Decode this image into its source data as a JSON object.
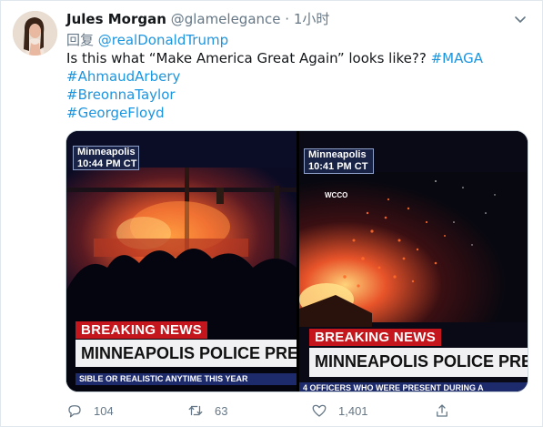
{
  "tweet": {
    "author_name": "Jules Morgan",
    "handle": "@glamelegance",
    "separator": "·",
    "time": "1小时",
    "reply_prefix": "回复",
    "reply_to": "@realDonaldTrump",
    "text_line1": "Is this what “Make America Great Again” looks like??",
    "hashtags": [
      "#MAGA",
      "#AhmaudArbery",
      "#BreonnaTaylor",
      "#GeorgeFloyd"
    ]
  },
  "media": {
    "left": {
      "city": "Minneapolis",
      "time": "10:44 PM CT",
      "breaking": "BREAKING NEWS",
      "headline": "MINNEAPOLIS POLICE PRECINCT ON F",
      "ticker": "SIBLE OR REALISTIC ANYTIME THIS YEAR"
    },
    "right": {
      "city": "Minneapolis",
      "time": "10:41 PM CT",
      "station": "WCCO",
      "breaking": "BREAKING NEWS",
      "headline": "MINNEAPOLIS POLICE PRECINCT ON",
      "ticker": "4 OFFICERS WHO WERE PRESENT DURING A"
    }
  },
  "actions": {
    "reply_count": "104",
    "retweet_count": "63",
    "like_count": "1,401"
  },
  "icons": {
    "reply": "reply-icon",
    "retweet": "retweet-icon",
    "like": "heart-icon",
    "share": "share-icon",
    "more": "chevron-down-icon"
  },
  "colors": {
    "link": "#1b95e0",
    "muted": "#657786",
    "breaking_red": "#c4161c",
    "ticker_blue": "#1d2a6b"
  }
}
